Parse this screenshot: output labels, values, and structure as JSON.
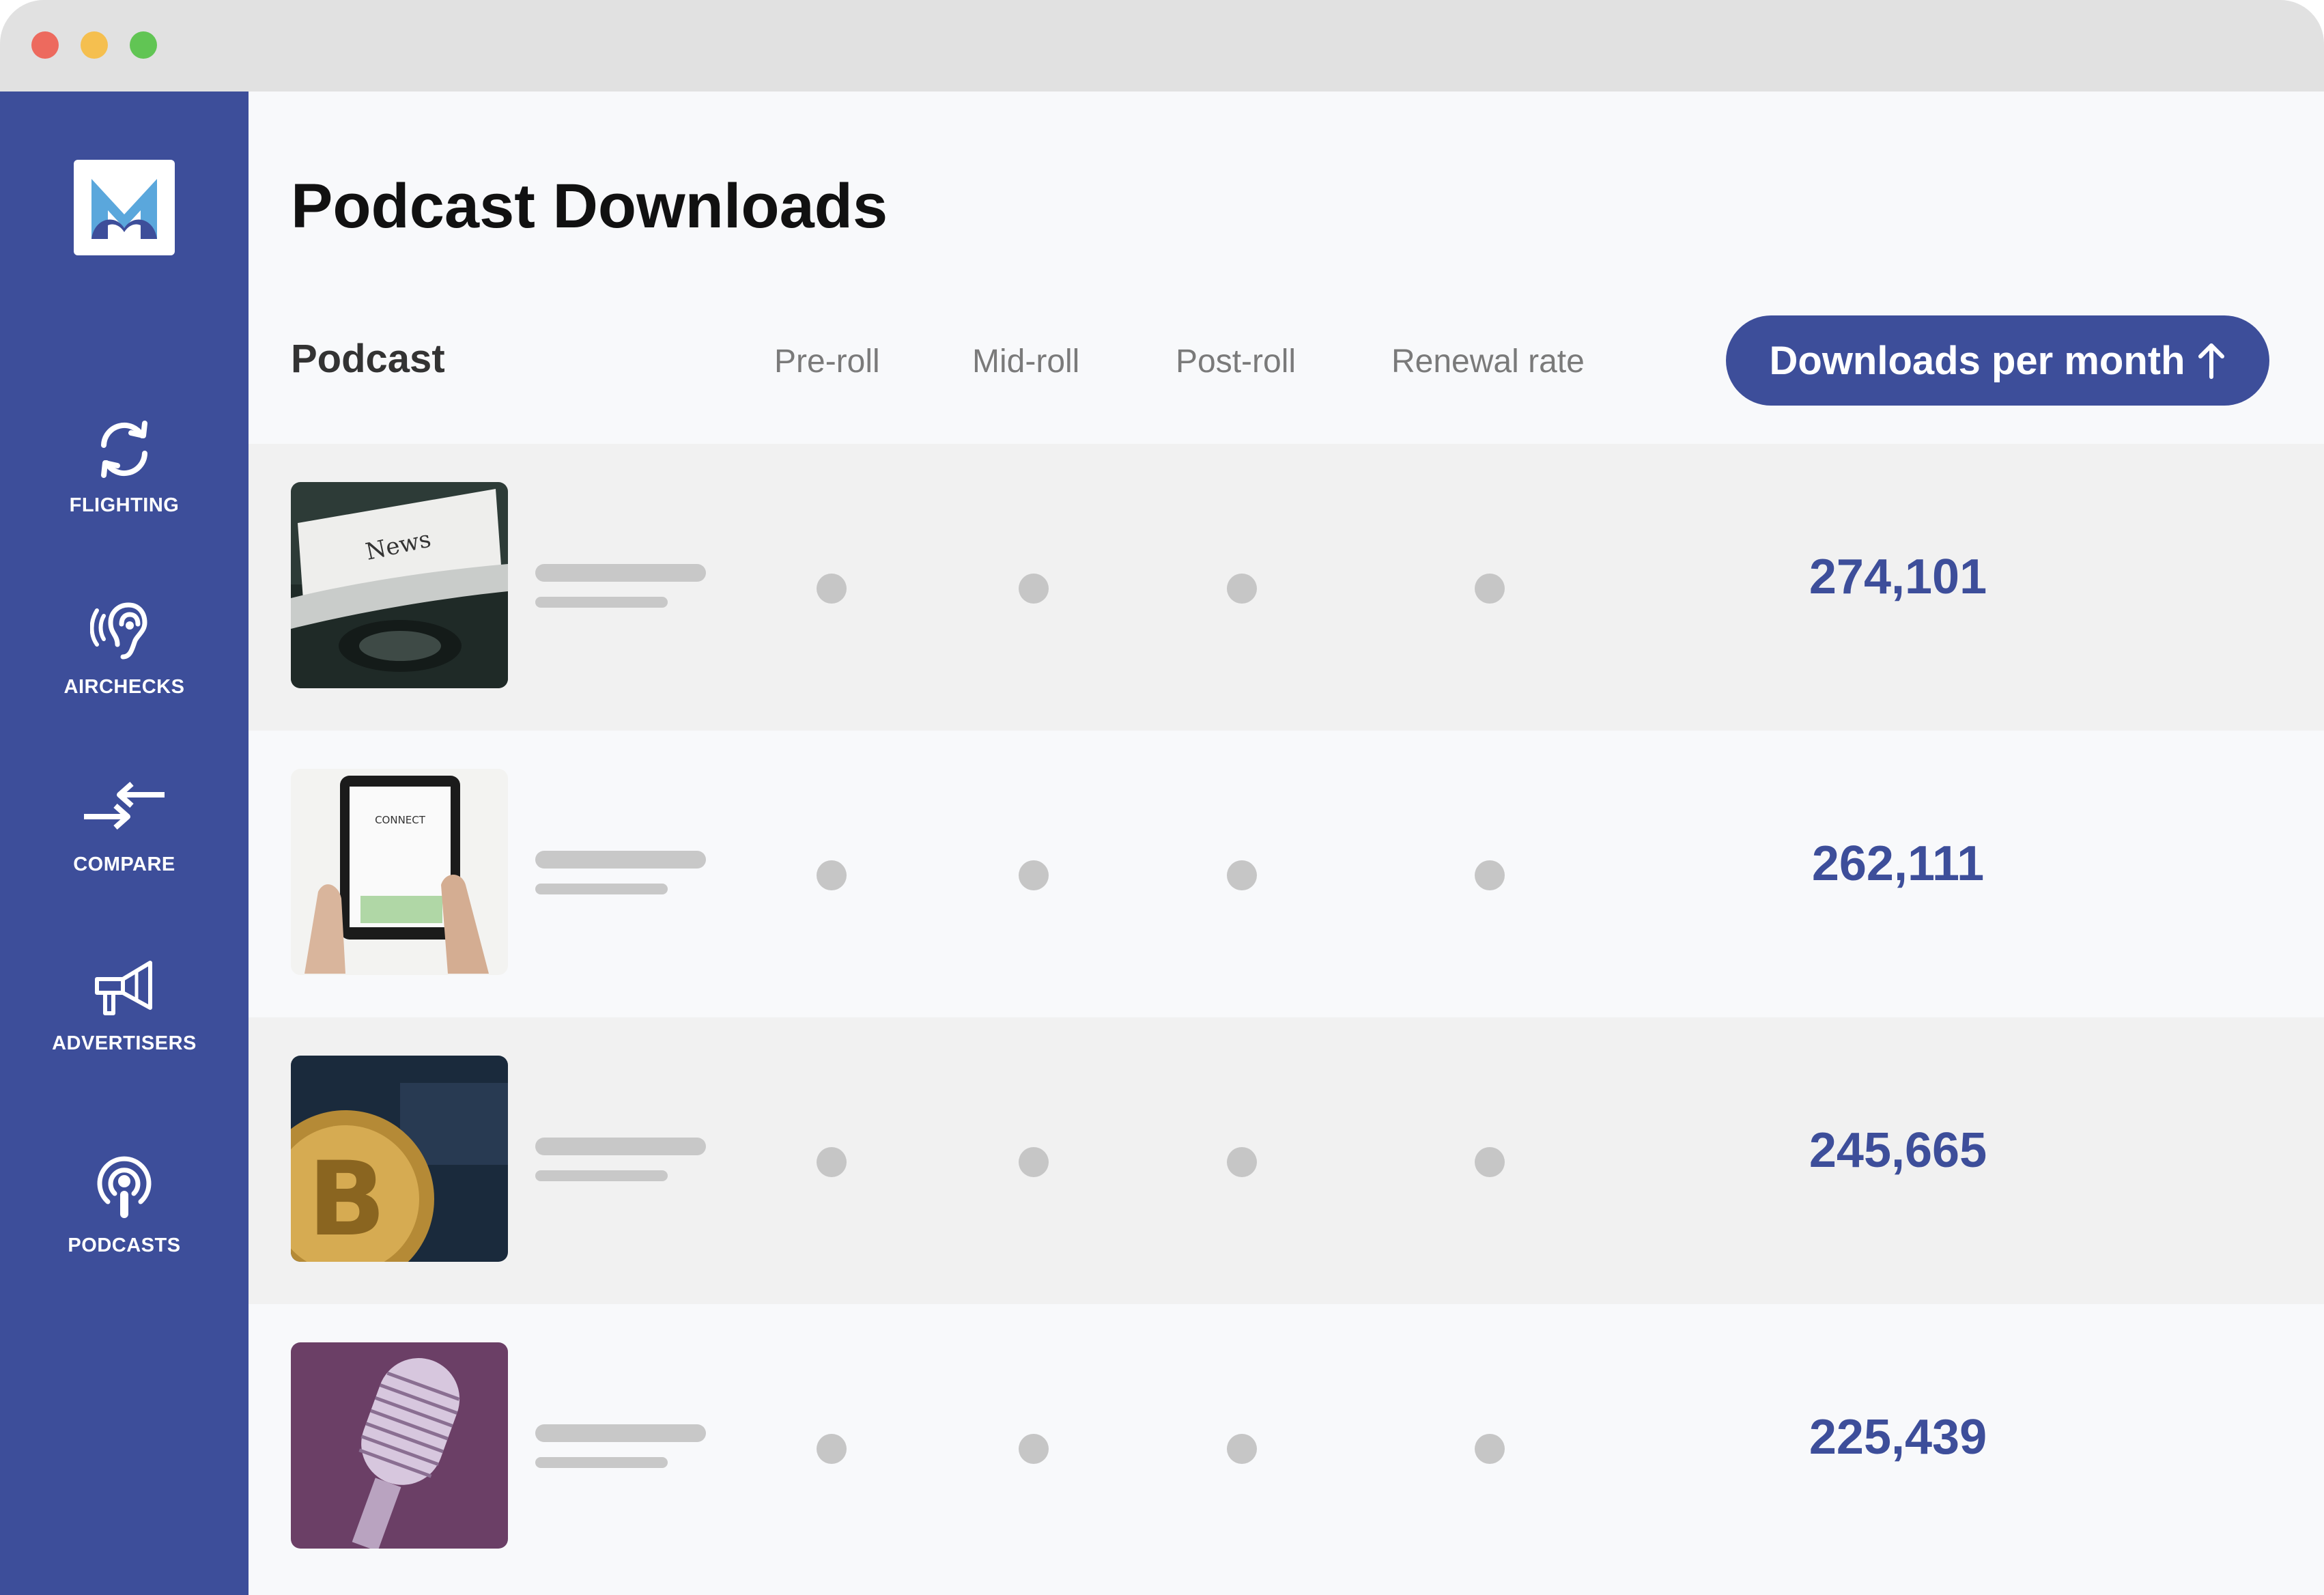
{
  "colors": {
    "sidebar": "#3d4e9a",
    "accent": "#3d4e9a",
    "row_shade": "#f1f1f1",
    "background": "#f8f9fb"
  },
  "sidebar": {
    "logo_icon": "brand-m-logo",
    "items": [
      {
        "label": "FLIGHTING",
        "icon": "refresh-icon"
      },
      {
        "label": "AIRCHECKS",
        "icon": "ear-icon"
      },
      {
        "label": "COMPARE",
        "icon": "compare-arrows-icon"
      },
      {
        "label": "ADVERTISERS",
        "icon": "megaphone-icon"
      },
      {
        "label": "PODCASTS",
        "icon": "podcast-icon"
      }
    ]
  },
  "page": {
    "title": "Podcast Downloads"
  },
  "table": {
    "columns": {
      "podcast": "Podcast",
      "preroll": "Pre-roll",
      "midroll": "Mid-roll",
      "postroll": "Post-roll",
      "renewal": "Renewal rate",
      "downloads": "Downloads per month",
      "sort_icon": "arrow-up-icon"
    },
    "rows": [
      {
        "thumbnail": "typewriter-news-image",
        "downloads": "274,101"
      },
      {
        "thumbnail": "tablet-connect-image",
        "downloads": "262,111"
      },
      {
        "thumbnail": "bitcoin-coin-image",
        "downloads": "245,665"
      },
      {
        "thumbnail": "microphone-image",
        "downloads": "225,439"
      }
    ]
  }
}
